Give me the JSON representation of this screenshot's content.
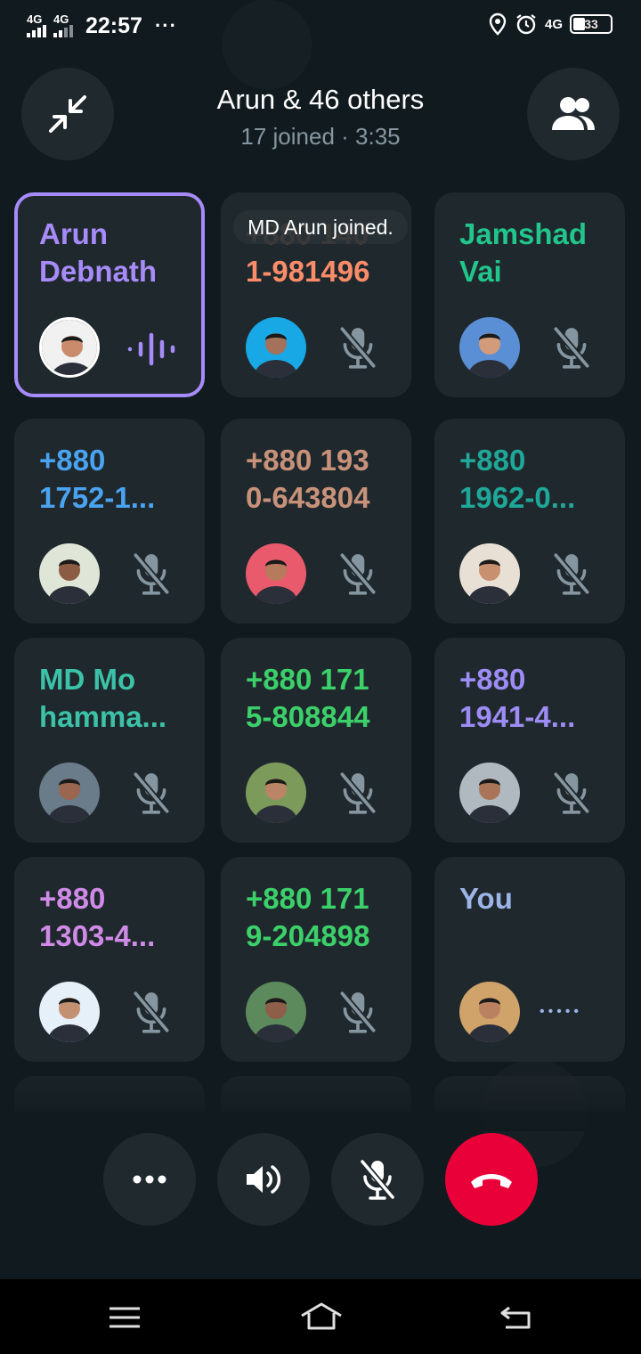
{
  "status_bar": {
    "signal1_label": "4G",
    "signal2_label": "4G",
    "time": "22:57",
    "more": "···",
    "network": "4G",
    "battery": "33"
  },
  "header": {
    "title": "Arun & 46 others",
    "subtitle": "17 joined · 3:35"
  },
  "toast": "MD Arun joined.",
  "participants": [
    {
      "name": "Arun\nDebnath",
      "color": "#a78bfa",
      "state": "speaking"
    },
    {
      "name": "+880 140\n1-981496",
      "color": "#fb8c6a",
      "state": "muted"
    },
    {
      "name": "Jamshad\nVai",
      "color": "#22c58b",
      "state": "muted"
    },
    {
      "name": "+880\n1752-1...",
      "color": "#4aa3f0",
      "state": "muted"
    },
    {
      "name": "+880 193\n0-643804",
      "color": "#c8927a",
      "state": "muted"
    },
    {
      "name": "+880\n1962-0...",
      "color": "#1fa89a",
      "state": "muted"
    },
    {
      "name": "MD Mo\nhamma...",
      "color": "#3cc2a8",
      "state": "muted"
    },
    {
      "name": "+880 171\n5-808844",
      "color": "#3cd06a",
      "state": "muted"
    },
    {
      "name": "+880\n1941-4...",
      "color": "#9d8cf5",
      "state": "muted"
    },
    {
      "name": "+880\n1303-4...",
      "color": "#d08ae8",
      "state": "muted"
    },
    {
      "name": "+880 171\n9-204898",
      "color": "#3cd06a",
      "state": "muted"
    },
    {
      "name": "You",
      "color": "#9cb4e8",
      "state": "connecting"
    }
  ],
  "icons": {
    "minimize": "minimize-icon",
    "participants": "participants-icon",
    "more": "more-icon",
    "speaker": "speaker-icon",
    "mic": "mic-off-icon",
    "end": "end-call-icon"
  },
  "colors": {
    "background": "#111b1f",
    "tile": "#1f282c",
    "end_call": "#ea0038",
    "speaking_border": "#a78bfa"
  }
}
